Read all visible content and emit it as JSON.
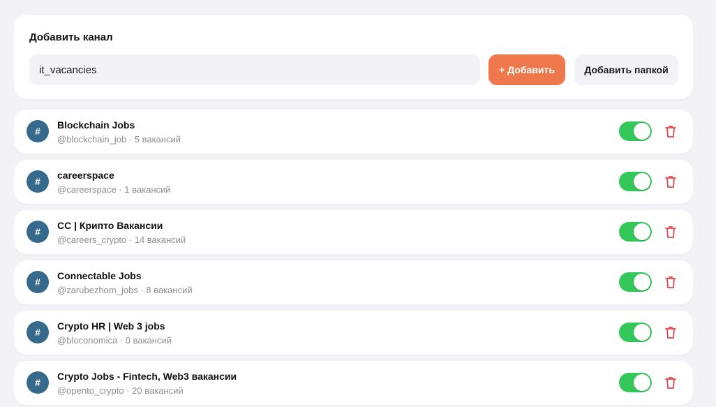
{
  "add_channel": {
    "title": "Добавить канал",
    "input_value": "it_vacancies",
    "add_button_label": "+ Добавить",
    "add_folder_button_label": "Добавить папкой"
  },
  "colors": {
    "accent": "#ee774b",
    "toggle_on": "#34c759",
    "avatar": "#356a8c",
    "delete": "#e5484d",
    "background": "#f2f2f7"
  },
  "channels": [
    {
      "avatar_symbol": "#",
      "name": "Blockchain Jobs",
      "meta": "@blockchain_job · 5 вакансий",
      "enabled": true,
      "toggle_icon": "toggle-on",
      "delete_icon": "trash-icon"
    },
    {
      "avatar_symbol": "#",
      "name": "careerspace",
      "meta": "@careerspace · 1 вакансий",
      "enabled": true,
      "toggle_icon": "toggle-on",
      "delete_icon": "trash-icon"
    },
    {
      "avatar_symbol": "#",
      "name": "CC | Крипто Вакансии",
      "meta": "@careers_crypto · 14 вакансий",
      "enabled": true,
      "toggle_icon": "toggle-on",
      "delete_icon": "trash-icon"
    },
    {
      "avatar_symbol": "#",
      "name": "Connectable Jobs",
      "meta": "@zarubezhom_jobs · 8 вакансий",
      "enabled": true,
      "toggle_icon": "toggle-on",
      "delete_icon": "trash-icon"
    },
    {
      "avatar_symbol": "#",
      "name": "Crypto HR | Web 3 jobs",
      "meta": "@bloconomica · 0 вакансий",
      "enabled": true,
      "toggle_icon": "toggle-on",
      "delete_icon": "trash-icon"
    },
    {
      "avatar_symbol": "#",
      "name": "Crypto Jobs - Fintech, Web3 вакансии",
      "meta": "@opento_crypto · 20 вакансий",
      "enabled": true,
      "toggle_icon": "toggle-on",
      "delete_icon": "trash-icon"
    }
  ]
}
